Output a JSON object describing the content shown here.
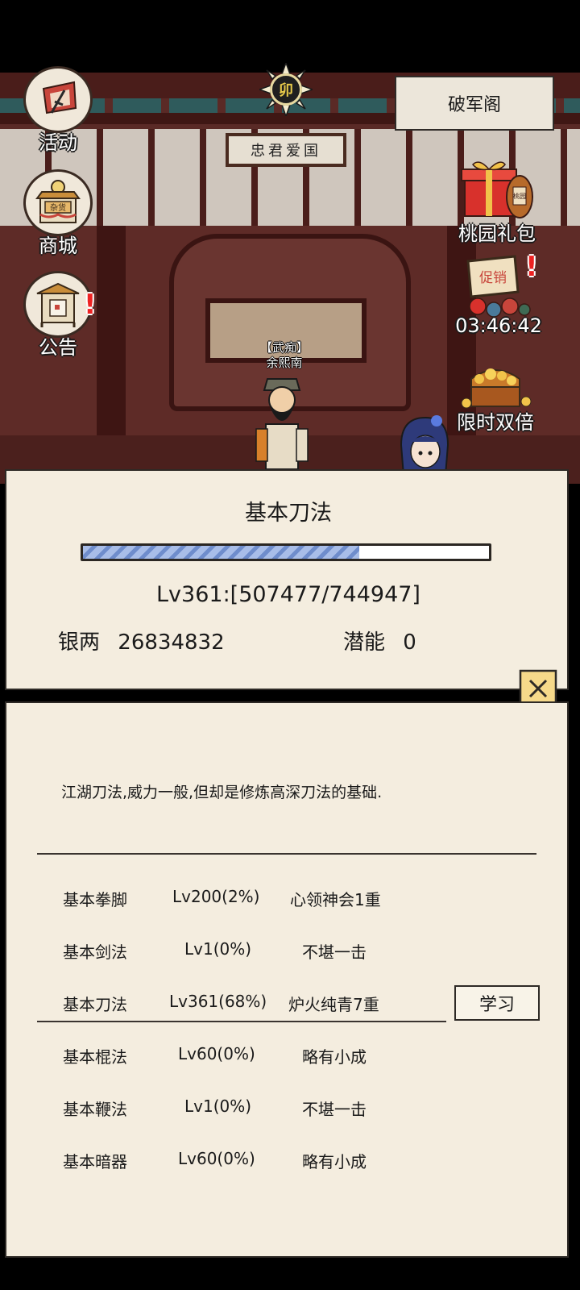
{
  "scene": {
    "plaque_text": "忠君爱国",
    "time_badge": "卯",
    "location": "破军阁",
    "npc": {
      "title": "【武痴】",
      "name": "余熙南"
    }
  },
  "left_menu": [
    {
      "label": "活动",
      "icon": "banner-sword-icon"
    },
    {
      "label": "商城",
      "icon": "shop-stall-icon",
      "sign": "杂货"
    },
    {
      "label": "公告",
      "icon": "notice-board-icon",
      "alert": "!"
    }
  ],
  "right_menu": {
    "gift": {
      "label": "桃园礼包",
      "tag": "桃园",
      "icon": "gift-box-icon"
    },
    "sale": {
      "sign": "促销",
      "timer": "03:46:42",
      "icon": "sale-sign-icon",
      "alert": "!"
    },
    "double": {
      "label": "限时双倍",
      "icon": "treasure-chest-icon"
    }
  },
  "skill_panel": {
    "title": "基本刀法",
    "progress": {
      "current": 507477,
      "max": 744947,
      "fraction": 0.681
    },
    "level_text": "Lv361:[507477/744947]",
    "silver_label": "银两",
    "silver_value": "26834832",
    "potential_label": "潜能",
    "potential_value": "0"
  },
  "detail_panel": {
    "description": "江湖刀法,威力一般,但却是修炼高深刀法的基础.",
    "learn_label": "学习",
    "skills": [
      {
        "name": "基本拳脚",
        "level": "Lv200(2%)",
        "rank": "心领神会1重"
      },
      {
        "name": "基本剑法",
        "level": "Lv1(0%)",
        "rank": "不堪一击"
      },
      {
        "name": "基本刀法",
        "level": "Lv361(68%)",
        "rank": "炉火纯青7重"
      },
      {
        "name": "基本棍法",
        "level": "Lv60(0%)",
        "rank": "略有小成"
      },
      {
        "name": "基本鞭法",
        "level": "Lv1(0%)",
        "rank": "不堪一击"
      },
      {
        "name": "基本暗器",
        "level": "Lv60(0%)",
        "rank": "略有小成"
      }
    ]
  },
  "colors": {
    "panel_bg": "#f4eddf",
    "progress_fill": "#8aa3dc",
    "alert_red": "#e22222"
  }
}
